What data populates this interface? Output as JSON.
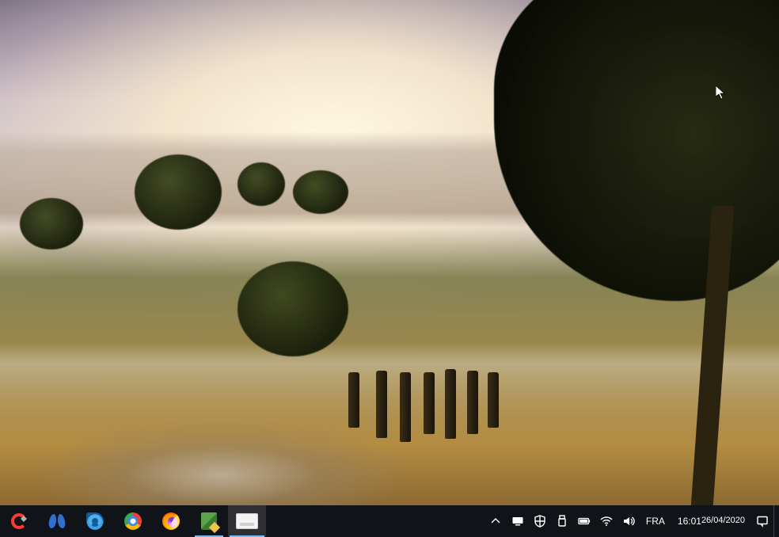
{
  "taskbar": {
    "pinned": [
      {
        "name": "ccleaner",
        "label": "CCleaner",
        "running": false,
        "active": false
      },
      {
        "name": "malwarebytes",
        "label": "Malwarebytes",
        "running": false,
        "active": false
      },
      {
        "name": "edge",
        "label": "Microsoft Edge",
        "running": false,
        "active": false
      },
      {
        "name": "chrome",
        "label": "Google Chrome",
        "running": false,
        "active": false
      },
      {
        "name": "firefox",
        "label": "Firefox",
        "running": false,
        "active": false
      },
      {
        "name": "notepad",
        "label": "Text Editor",
        "running": true,
        "active": false
      },
      {
        "name": "deviceapp",
        "label": "Application",
        "running": true,
        "active": true
      }
    ],
    "tray": {
      "chevron": "⌃",
      "language": "FRA",
      "time": "16:01",
      "date": "26/04/2020"
    }
  }
}
